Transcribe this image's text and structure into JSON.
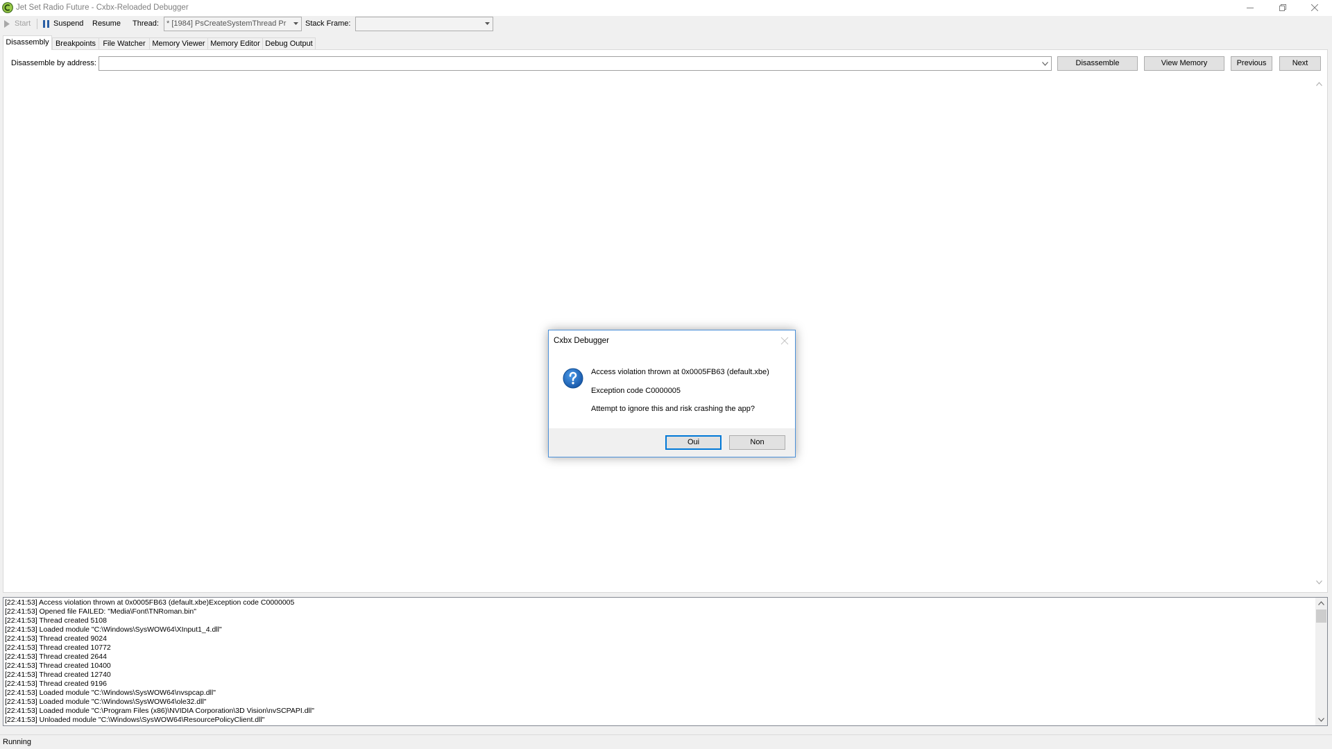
{
  "window": {
    "title": "Jet Set Radio Future - Cxbx-Reloaded Debugger",
    "icon": "cxbx-app-icon",
    "controls": {
      "minimize": "minimize-icon",
      "restore": "restore-icon",
      "close": "close-icon"
    }
  },
  "toolbar": {
    "start_label": "Start",
    "start_icon": "play-icon",
    "start_enabled": false,
    "suspend_label": "Suspend",
    "suspend_icon": "pause-icon",
    "resume_label": "Resume",
    "thread_label": "Thread:",
    "thread_selected": "* [1984] PsCreateSystemThread Pr",
    "stack_frame_label": "Stack Frame:",
    "stack_frame_selected": ""
  },
  "tabs": [
    {
      "label": "Disassembly",
      "selected": true
    },
    {
      "label": "Breakpoints",
      "selected": false
    },
    {
      "label": "File Watcher",
      "selected": false
    },
    {
      "label": "Memory Viewer",
      "selected": false
    },
    {
      "label": "Memory Editor",
      "selected": false
    },
    {
      "label": "Debug Output",
      "selected": false
    }
  ],
  "disassembly": {
    "address_label": "Disassemble by address:",
    "address_value": "",
    "disassemble_button": "Disassemble",
    "view_memory_button": "View Memory",
    "previous_button": "Previous",
    "next_button": "Next"
  },
  "debug_log": {
    "lines": [
      "[22:41:53] Access violation thrown at 0x0005FB63 (default.xbe)Exception code C0000005",
      "[22:41:53] Opened file FAILED: \"Media\\Font\\TNRoman.bin\"",
      "[22:41:53] Thread created 5108",
      "[22:41:53] Loaded module \"C:\\Windows\\SysWOW64\\XInput1_4.dll\"",
      "[22:41:53] Thread created 9024",
      "[22:41:53] Thread created 10772",
      "[22:41:53] Thread created 2644",
      "[22:41:53] Thread created 10400",
      "[22:41:53] Thread created 12740",
      "[22:41:53] Thread created 9196",
      "[22:41:53] Loaded module \"C:\\Windows\\SysWOW64\\nvspcap.dll\"",
      "[22:41:53] Loaded module \"C:\\Windows\\SysWOW64\\ole32.dll\"",
      "[22:41:53] Loaded module \"C:\\Program Files (x86)\\NVIDIA Corporation\\3D Vision\\nvSCPAPI.dll\"",
      "[22:41:53] Unloaded module \"C:\\Windows\\SysWOW64\\ResourcePolicyClient.dll\""
    ]
  },
  "status_bar": {
    "text": "Running"
  },
  "dialog": {
    "title": "Cxbx Debugger",
    "icon": "question-icon",
    "message_lines": [
      "Access violation thrown at 0x0005FB63 (default.xbe)",
      "Exception code C0000005",
      "Attempt to ignore this and risk crashing the app?"
    ],
    "yes_button": "Oui",
    "no_button": "Non",
    "close_enabled": false
  },
  "colors": {
    "accent": "#0078d7",
    "question_icon": "#1c64b8",
    "dialog_border": "#4a90d9",
    "window_bg": "#f0f0f0"
  }
}
